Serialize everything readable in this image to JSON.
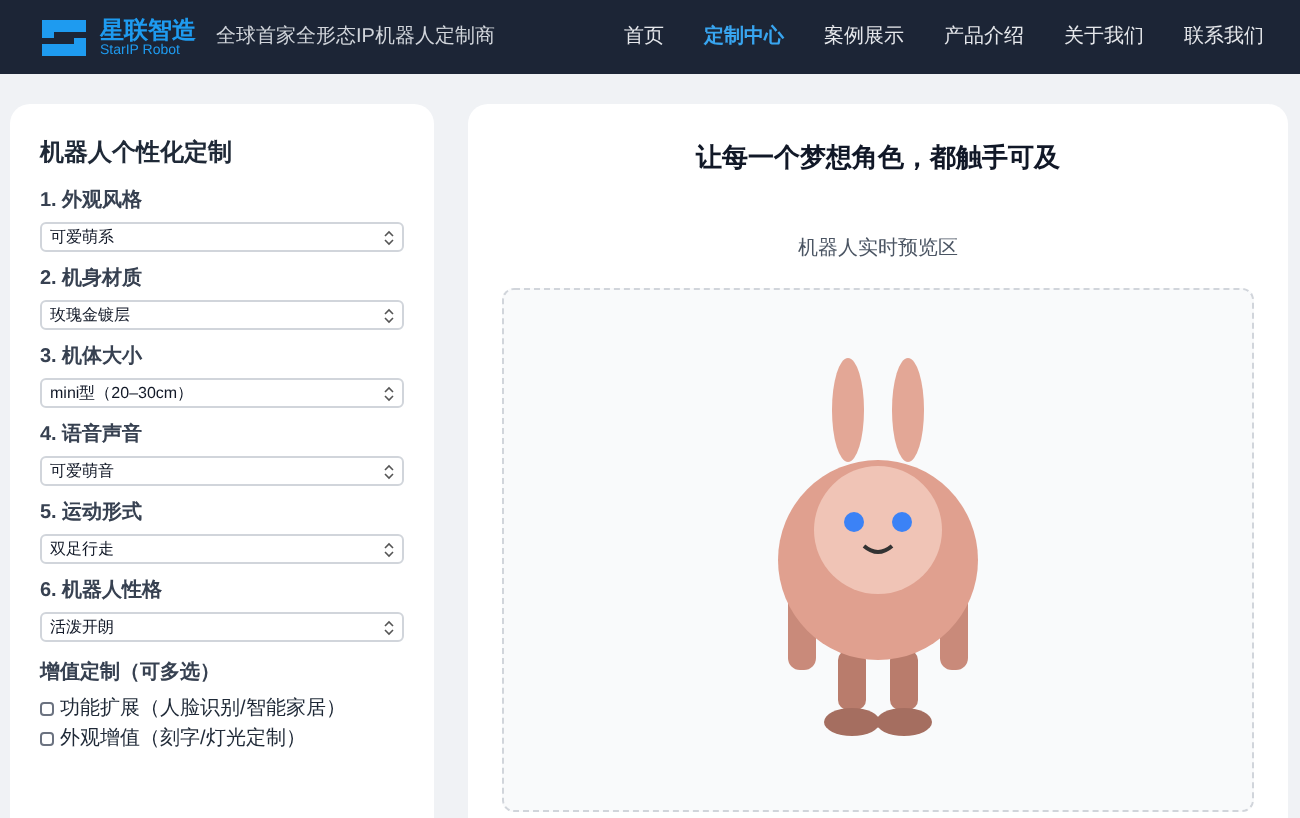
{
  "header": {
    "logo_name": "星联智造",
    "logo_subtitle": "StarIP Robot",
    "tagline": "全球首家全形态IP机器人定制商",
    "nav": [
      {
        "label": "首页",
        "selected": false
      },
      {
        "label": "定制中心",
        "selected": true
      },
      {
        "label": "案例展示",
        "selected": false
      },
      {
        "label": "产品介绍",
        "selected": false
      },
      {
        "label": "关于我们",
        "selected": false
      },
      {
        "label": "联系我们",
        "selected": false
      }
    ]
  },
  "form": {
    "title": "机器人个性化定制",
    "fields": [
      {
        "label": "1. 外观风格",
        "value": "可爱萌系"
      },
      {
        "label": "2. 机身材质",
        "value": "玫瑰金镀层"
      },
      {
        "label": "3. 机体大小",
        "value": "mini型（20–30cm）"
      },
      {
        "label": "4. 语音声音",
        "value": "可爱萌音"
      },
      {
        "label": "5. 运动形式",
        "value": "双足行走"
      },
      {
        "label": "6. 机器人性格",
        "value": "活泼开朗"
      }
    ],
    "addons_title": "增值定制（可多选）",
    "addons": [
      {
        "label": "功能扩展（人脸识别/智能家居）",
        "checked": false
      },
      {
        "label": "外观增值（刻字/灯光定制）",
        "checked": false
      }
    ]
  },
  "preview": {
    "slogan": "让每一个梦想角色，都触手可及",
    "title": "机器人实时预览区"
  }
}
